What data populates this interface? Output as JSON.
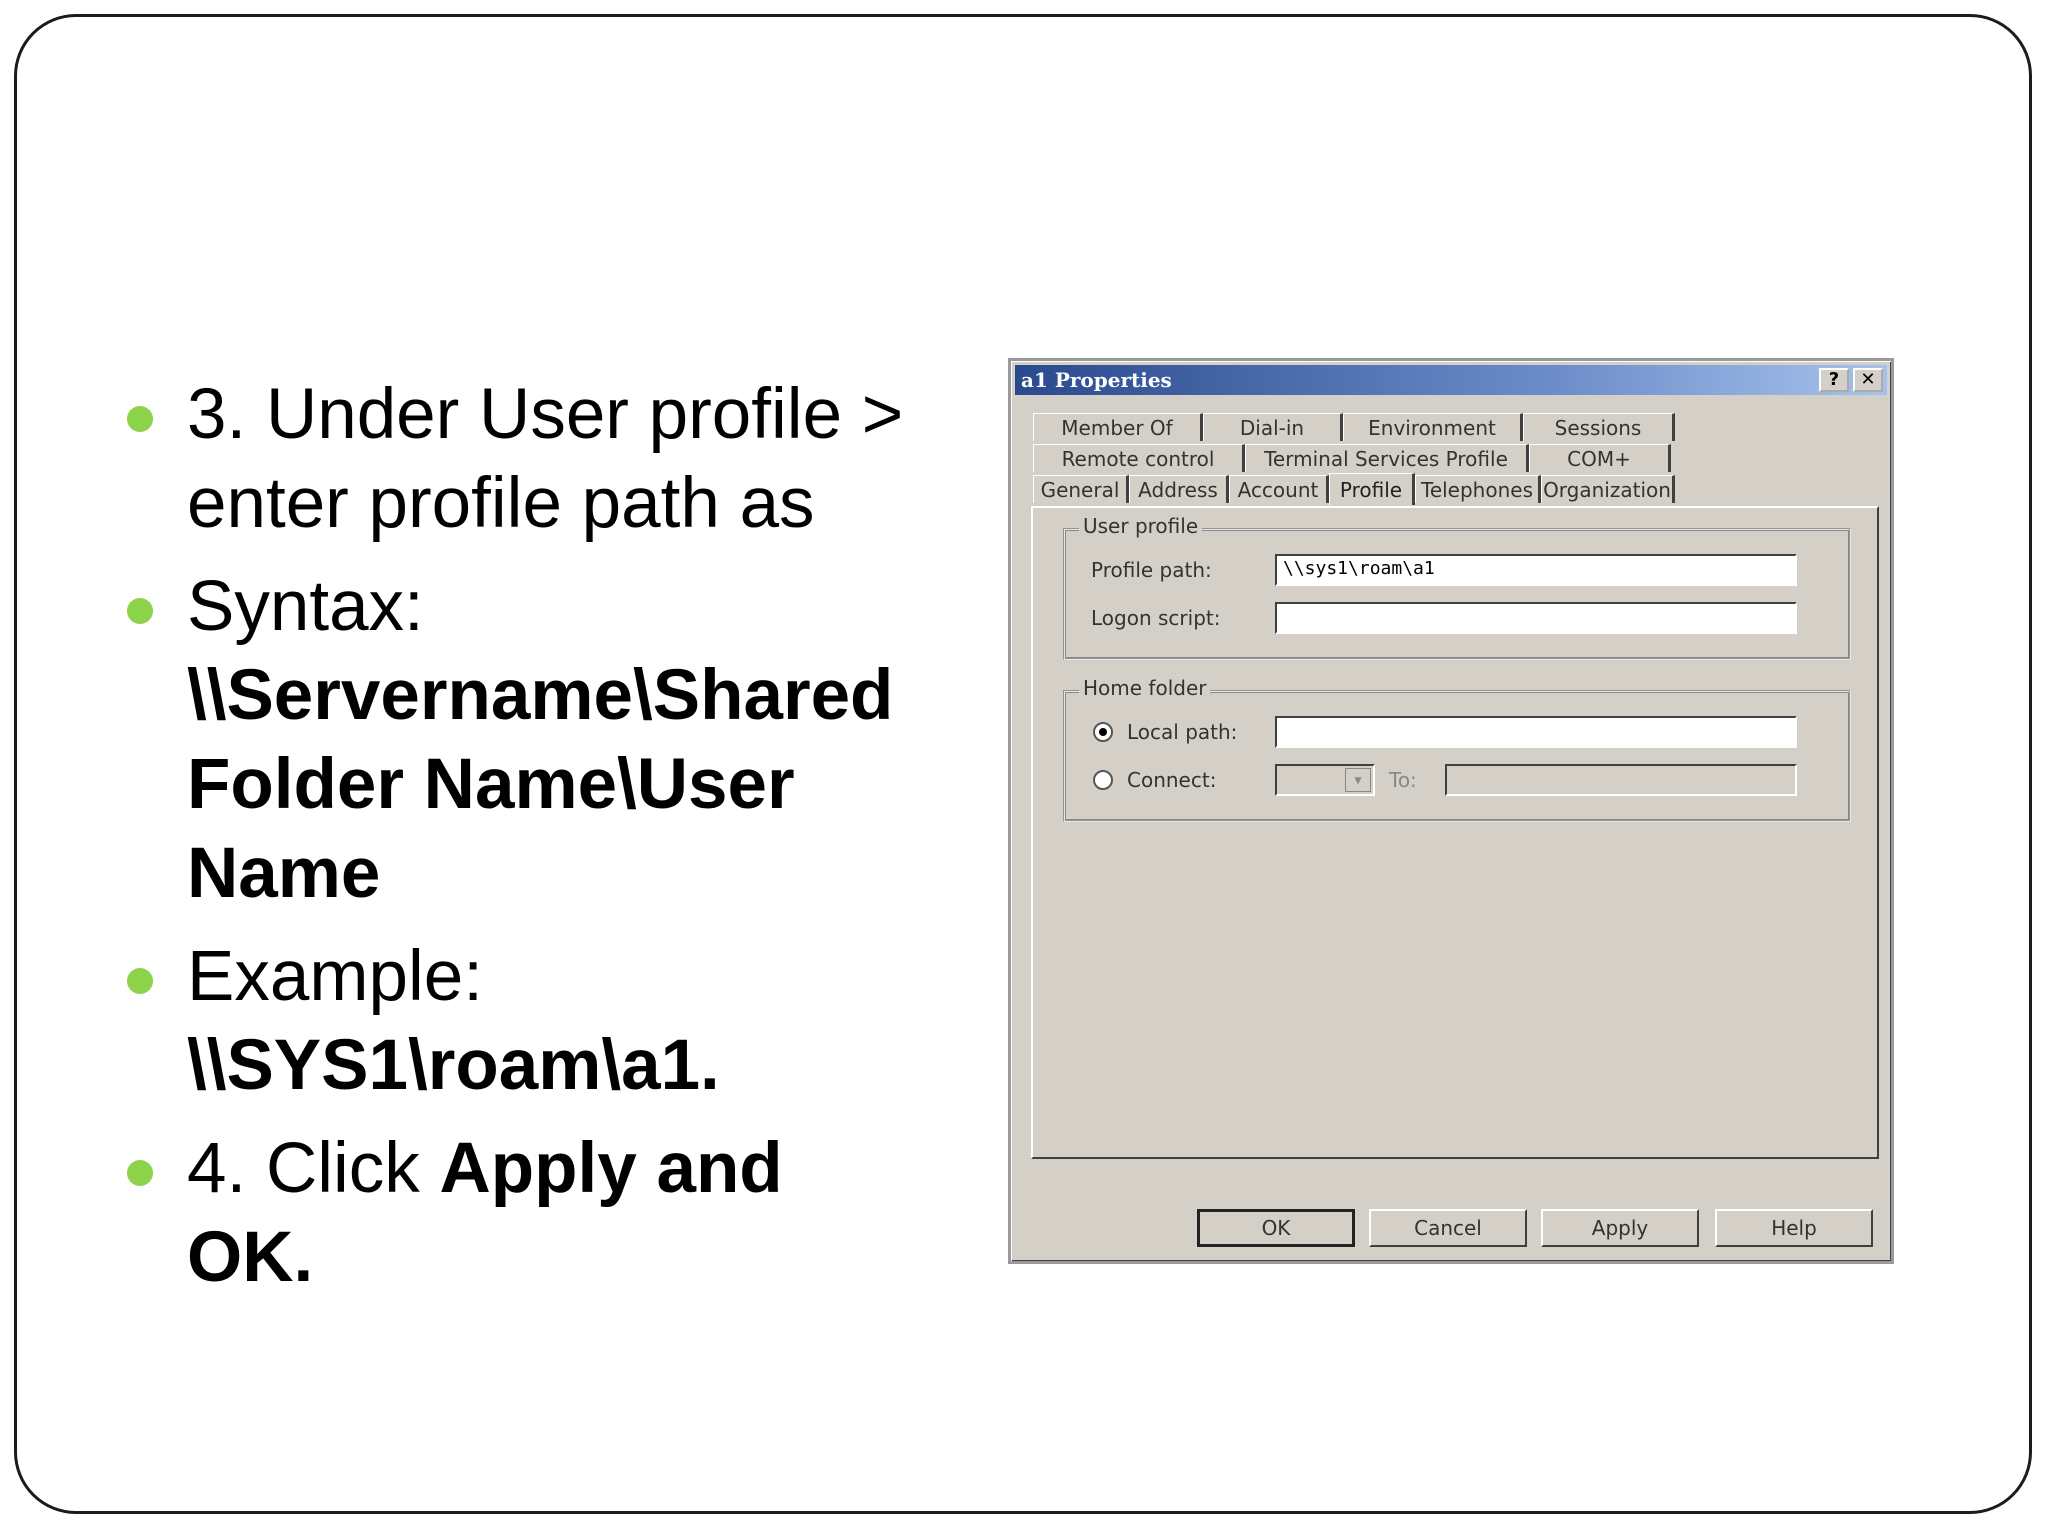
{
  "slide": {
    "bullets": [
      {
        "segments": [
          {
            "text": "3. Under User profile > enter profile path as",
            "bold": false
          }
        ]
      },
      {
        "segments": [
          {
            "text": "Syntax: ",
            "bold": false
          },
          {
            "text": "\\\\Servername\\Shared Folder Name\\User Name",
            "bold": true
          }
        ]
      },
      {
        "segments": [
          {
            "text": "Example: ",
            "bold": false
          },
          {
            "text": "\\\\SYS1\\roam\\a1.",
            "bold": true
          }
        ]
      },
      {
        "segments": [
          {
            "text": "4. Click ",
            "bold": false
          },
          {
            "text": "Apply and OK.",
            "bold": true
          }
        ]
      }
    ],
    "bullet_color": "#8cd34a"
  },
  "dialog": {
    "title": "a1 Properties",
    "help_button": "?",
    "close_button": "✕",
    "tab_rows": [
      [
        "Member Of",
        "Dial-in",
        "Environment",
        "Sessions"
      ],
      [
        "Remote control",
        "Terminal Services Profile",
        "COM+"
      ],
      [
        "General",
        "Address",
        "Account",
        "Profile",
        "Telephones",
        "Organization"
      ]
    ],
    "active_tab": "Profile",
    "user_profile": {
      "group_label": "User profile",
      "profile_path_label": "Profile path:",
      "profile_path_value": "\\\\sys1\\roam\\a1",
      "logon_script_label": "Logon script:",
      "logon_script_value": ""
    },
    "home_folder": {
      "group_label": "Home folder",
      "local_path_label": "Local path:",
      "local_path_value": "",
      "connect_label": "Connect:",
      "to_label": "To:"
    },
    "buttons": {
      "ok": "OK",
      "cancel": "Cancel",
      "apply": "Apply",
      "help": "Help"
    }
  }
}
